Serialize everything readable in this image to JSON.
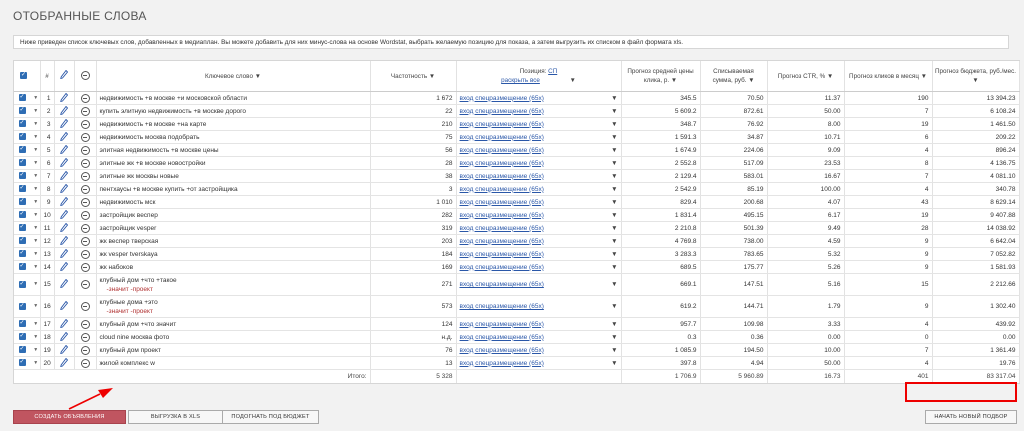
{
  "page": {
    "title": "ОТОБРАННЫЕ СЛОВА",
    "intro": "Ниже приведен список ключевых слов, добавленных в медиаплан. Вы можете добавить для них минус-слова на основе Wordstat, выбрать желаемую позицию для показа, а затем выгрузить их списком в файл формата xls."
  },
  "columns": {
    "num": "#",
    "keyword": "Ключевое слово ▼",
    "frequency": "Частотность ▼",
    "position_prefix": "Позиция:",
    "position_sp": "СП",
    "position_expand": "раскрыть все",
    "position_sort": "▼",
    "price": "Прогноз средней цены клика, р. ▼",
    "charge": "Списываемая сумма, руб. ▼",
    "ctr": "Прогноз CTR, % ▼",
    "clicks": "Прогноз кликов в месяц ▼",
    "budget": "Прогноз бюджета, руб./мес. ▼"
  },
  "rows": [
    {
      "n": "1",
      "kw": "недвижимость +в москве +и московской области",
      "freq": "1 672",
      "pos": "вход спецразмещение (65х)",
      "price": "345.5",
      "charge": "70.50",
      "ctr": "11.37",
      "clicks": "190",
      "budget": "13 394.23"
    },
    {
      "n": "2",
      "kw": "купить элитную недвижимость +в москве дорого",
      "freq": "22",
      "pos": "вход спецразмещение (65х)",
      "price": "5 609.2",
      "charge": "872.61",
      "ctr": "50.00",
      "clicks": "7",
      "budget": "6 108.24"
    },
    {
      "n": "3",
      "kw": "недвижимость +в москве +на карте",
      "freq": "210",
      "pos": "вход спецразмещение (65х)",
      "price": "348.7",
      "charge": "76.92",
      "ctr": "8.00",
      "clicks": "19",
      "budget": "1 461.50"
    },
    {
      "n": "4",
      "kw": "недвижимость москва подобрать",
      "freq": "75",
      "pos": "вход спецразмещение (65х)",
      "price": "1 591.3",
      "charge": "34.87",
      "ctr": "10.71",
      "clicks": "6",
      "budget": "209.22"
    },
    {
      "n": "5",
      "kw": "элитная недвижимость +в москве цены",
      "freq": "56",
      "pos": "вход спецразмещение (65х)",
      "price": "1 674.9",
      "charge": "224.06",
      "ctr": "9.09",
      "clicks": "4",
      "budget": "896.24"
    },
    {
      "n": "6",
      "kw": "элитные жк +в москве новостройки",
      "freq": "28",
      "pos": "вход спецразмещение (65х)",
      "price": "2 552.8",
      "charge": "517.09",
      "ctr": "23.53",
      "clicks": "8",
      "budget": "4 136.75"
    },
    {
      "n": "7",
      "kw": "элитные жк москвы новые",
      "freq": "38",
      "pos": "вход спецразмещение (65х)",
      "price": "2 129.4",
      "charge": "583.01",
      "ctr": "16.67",
      "clicks": "7",
      "budget": "4 081.10"
    },
    {
      "n": "8",
      "kw": "пентхаусы +в москве купить +от застройщика",
      "freq": "3",
      "pos": "вход спецразмещение (65х)",
      "price": "2 542.9",
      "charge": "85.19",
      "ctr": "100.00",
      "clicks": "4",
      "budget": "340.78"
    },
    {
      "n": "9",
      "kw": "недвижимость мск",
      "freq": "1 010",
      "pos": "вход спецразмещение (65х)",
      "price": "829.4",
      "charge": "200.68",
      "ctr": "4.07",
      "clicks": "43",
      "budget": "8 629.14"
    },
    {
      "n": "10",
      "kw": "застройщик веспер",
      "freq": "282",
      "pos": "вход спецразмещение (65х)",
      "price": "1 831.4",
      "charge": "495.15",
      "ctr": "6.17",
      "clicks": "19",
      "budget": "9 407.88"
    },
    {
      "n": "11",
      "kw": "застройщик vesper",
      "freq": "319",
      "pos": "вход спецразмещение (65х)",
      "price": "2 210.8",
      "charge": "501.39",
      "ctr": "9.49",
      "clicks": "28",
      "budget": "14 038.92"
    },
    {
      "n": "12",
      "kw": "жк веспер тверская",
      "freq": "203",
      "pos": "вход спецразмещение (65х)",
      "price": "4 769.8",
      "charge": "738.00",
      "ctr": "4.59",
      "clicks": "9",
      "budget": "6 642.04"
    },
    {
      "n": "13",
      "kw": "жк vesper tverskaya",
      "freq": "184",
      "pos": "вход спецразмещение (65х)",
      "price": "3 283.3",
      "charge": "783.65",
      "ctr": "5.32",
      "clicks": "9",
      "budget": "7 052.82"
    },
    {
      "n": "14",
      "kw": "жк набоков",
      "freq": "169",
      "pos": "вход спецразмещение (65х)",
      "price": "689.5",
      "charge": "175.77",
      "ctr": "5.26",
      "clicks": "9",
      "budget": "1 581.93"
    },
    {
      "n": "15",
      "kw": "клубный дом +что +такое",
      "minus": "-значит -проект",
      "freq": "271",
      "pos": "вход спецразмещение (65х)",
      "price": "669.1",
      "charge": "147.51",
      "ctr": "5.16",
      "clicks": "15",
      "budget": "2 212.66"
    },
    {
      "n": "16",
      "kw": "клубные дома +это",
      "minus": "-значит -проект",
      "freq": "573",
      "pos": "вход спецразмещение (65х)",
      "price": "619.2",
      "charge": "144.71",
      "ctr": "1.79",
      "clicks": "9",
      "budget": "1 302.40"
    },
    {
      "n": "17",
      "kw": "клубный дом +что значит",
      "freq": "124",
      "pos": "вход спецразмещение (65х)",
      "price": "957.7",
      "charge": "109.98",
      "ctr": "3.33",
      "clicks": "4",
      "budget": "439.92"
    },
    {
      "n": "18",
      "kw": "cloud nine москва фото",
      "freq": "н.д.",
      "pos": "вход спецразмещение (65х)",
      "price": "0.3",
      "charge": "0.36",
      "ctr": "0.00",
      "clicks": "0",
      "budget": "0.00"
    },
    {
      "n": "19",
      "kw": "клубный дом проект",
      "freq": "76",
      "pos": "вход спецразмещение (65х)",
      "price": "1 085.9",
      "charge": "194.50",
      "ctr": "10.00",
      "clicks": "7",
      "budget": "1 361.49"
    },
    {
      "n": "20",
      "kw": "жилой комплекс w",
      "freq": "13",
      "pos": "вход спецразмещение (65х)",
      "price": "397.8",
      "charge": "4.94",
      "ctr": "50.00",
      "clicks": "4",
      "budget": "19.76"
    }
  ],
  "totals": {
    "label": "Итого:",
    "freq": "5 328",
    "price": "1 706.9",
    "charge": "5 960.89",
    "ctr": "16.73",
    "clicks": "401",
    "budget": "83 317.04"
  },
  "buttons": {
    "create": "СОЗДАТЬ ОБЪЯВЛЕНИЯ",
    "export": "ВЫГРУЗКА В XLS",
    "fit": "ПОДОГНАТЬ ПОД БЮДЖЕТ",
    "new": "НАЧАТЬ НОВЫЙ ПОДБОР"
  },
  "colors": {
    "accent": "#c05560",
    "checkbox": "#2e6db4",
    "link": "#2a57a8",
    "highlight": "#e00000"
  },
  "icons": {
    "checkbox": "check-icon",
    "edit": "pencil-icon",
    "minus": "minus-circle-icon"
  }
}
